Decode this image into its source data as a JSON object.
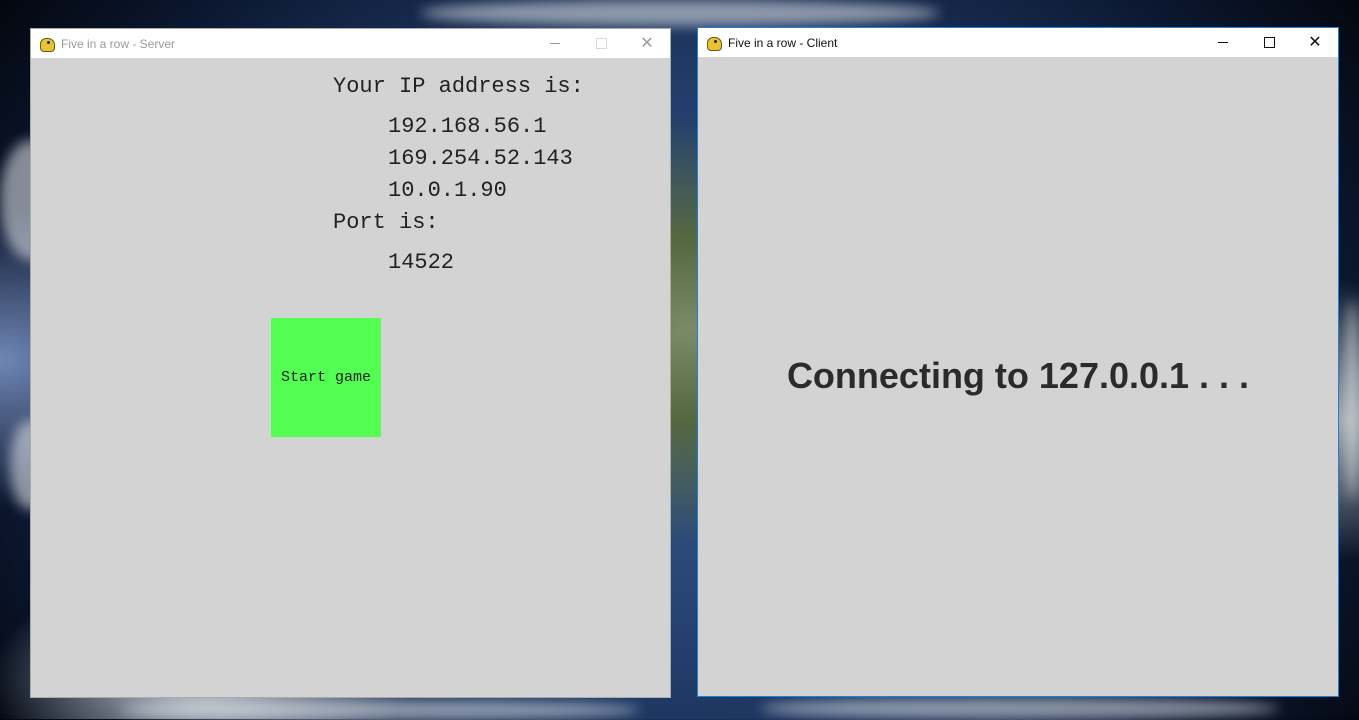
{
  "server_window": {
    "title": "Five in a row - Server",
    "ip_heading": "Your IP address is:",
    "ip_addresses": [
      "192.168.56.1",
      "169.254.52.143",
      "10.0.1.90"
    ],
    "port_heading": "Port is:",
    "port_value": "14522",
    "start_button_label": "Start game",
    "start_button_color": "#52fe52",
    "controls": {
      "minimize": "minimize-icon",
      "maximize": "maximize-icon",
      "close": "close-icon"
    }
  },
  "client_window": {
    "title": "Five in a row - Client",
    "status_text": "Connecting to 127.0.0.1 . . .",
    "controls": {
      "minimize": "minimize-icon",
      "maximize": "maximize-icon",
      "close": "close-icon"
    }
  },
  "colors": {
    "window_background": "#d3d3d3",
    "active_border": "#1883d7"
  },
  "icons": {
    "app_icon": "pygame-snake-icon"
  }
}
